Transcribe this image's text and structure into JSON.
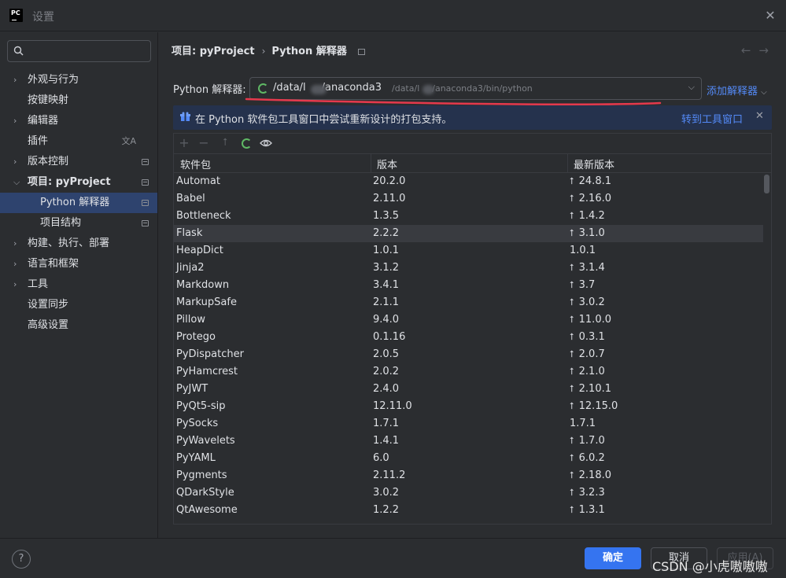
{
  "window": {
    "title": "设置",
    "close_icon": "close-icon"
  },
  "sidebar": {
    "search": {
      "value": "",
      "placeholder": ""
    },
    "items": [
      {
        "label": "外观与行为",
        "expandable": true,
        "expanded": false
      },
      {
        "label": "按键映射",
        "expandable": false
      },
      {
        "label": "编辑器",
        "expandable": true,
        "expanded": false
      },
      {
        "label": "插件",
        "expandable": false,
        "icon": "translate-icon"
      },
      {
        "label": "版本控制",
        "expandable": true,
        "expanded": false,
        "icon": "project-scope-icon"
      },
      {
        "label": "项目: pyProject",
        "expandable": true,
        "expanded": true,
        "icon": "project-scope-icon"
      },
      {
        "label": "Python 解释器",
        "sub": true,
        "selected": true,
        "icon": "project-scope-icon"
      },
      {
        "label": "项目结构",
        "sub": true,
        "icon": "project-scope-icon"
      },
      {
        "label": "构建、执行、部署",
        "expandable": true,
        "expanded": false
      },
      {
        "label": "语言和框架",
        "expandable": true,
        "expanded": false
      },
      {
        "label": "工具",
        "expandable": true,
        "expanded": false
      },
      {
        "label": "设置同步",
        "expandable": false
      },
      {
        "label": "高级设置",
        "expandable": false
      }
    ]
  },
  "main": {
    "breadcrumb": {
      "project": "项目: pyProject",
      "page": "Python 解释器"
    },
    "interpreter": {
      "label": "Python 解释器:",
      "path_prefix": "/data/l",
      "path_suffix": "/anaconda3",
      "subpath_prefix": "/data/l",
      "subpath_suffix": "/anaconda3/bin/python",
      "add_label": "添加解释器"
    },
    "banner": {
      "message": "在 Python 软件包工具窗口中尝试重新设计的打包支持。",
      "link": "转到工具窗口"
    },
    "table": {
      "headers": [
        "软件包",
        "版本",
        "最新版本"
      ],
      "rows": [
        {
          "name": "Automat",
          "version": "20.2.0",
          "latest": "24.8.1",
          "upgrade": true
        },
        {
          "name": "Babel",
          "version": "2.11.0",
          "latest": "2.16.0",
          "upgrade": true
        },
        {
          "name": "Bottleneck",
          "version": "1.3.5",
          "latest": "1.4.2",
          "upgrade": true
        },
        {
          "name": "Flask",
          "version": "2.2.2",
          "latest": "3.1.0",
          "upgrade": true
        },
        {
          "name": "HeapDict",
          "version": "1.0.1",
          "latest": "1.0.1",
          "upgrade": false
        },
        {
          "name": "Jinja2",
          "version": "3.1.2",
          "latest": "3.1.4",
          "upgrade": true
        },
        {
          "name": "Markdown",
          "version": "3.4.1",
          "latest": "3.7",
          "upgrade": true
        },
        {
          "name": "MarkupSafe",
          "version": "2.1.1",
          "latest": "3.0.2",
          "upgrade": true
        },
        {
          "name": "Pillow",
          "version": "9.4.0",
          "latest": "11.0.0",
          "upgrade": true
        },
        {
          "name": "Protego",
          "version": "0.1.16",
          "latest": "0.3.1",
          "upgrade": true
        },
        {
          "name": "PyDispatcher",
          "version": "2.0.5",
          "latest": "2.0.7",
          "upgrade": true
        },
        {
          "name": "PyHamcrest",
          "version": "2.0.2",
          "latest": "2.1.0",
          "upgrade": true
        },
        {
          "name": "PyJWT",
          "version": "2.4.0",
          "latest": "2.10.1",
          "upgrade": true
        },
        {
          "name": "PyQt5-sip",
          "version": "12.11.0",
          "latest": "12.15.0",
          "upgrade": true
        },
        {
          "name": "PySocks",
          "version": "1.7.1",
          "latest": "1.7.1",
          "upgrade": false
        },
        {
          "name": "PyWavelets",
          "version": "1.4.1",
          "latest": "1.7.0",
          "upgrade": true
        },
        {
          "name": "PyYAML",
          "version": "6.0",
          "latest": "6.0.2",
          "upgrade": true
        },
        {
          "name": "Pygments",
          "version": "2.11.2",
          "latest": "2.18.0",
          "upgrade": true
        },
        {
          "name": "QDarkStyle",
          "version": "3.0.2",
          "latest": "3.2.3",
          "upgrade": true
        },
        {
          "name": "QtAwesome",
          "version": "1.2.2",
          "latest": "1.3.1",
          "upgrade": true
        }
      ]
    }
  },
  "footer": {
    "help": "?",
    "ok": "确定",
    "cancel": "取消",
    "apply": "应用(A)",
    "watermark": "CSDN @小虎嗷嗷嗷"
  },
  "colors": {
    "accent": "#3574f0",
    "link": "#548af7",
    "selected": "#2e436e",
    "banner": "#25324d",
    "annotation": "#e5394c"
  }
}
